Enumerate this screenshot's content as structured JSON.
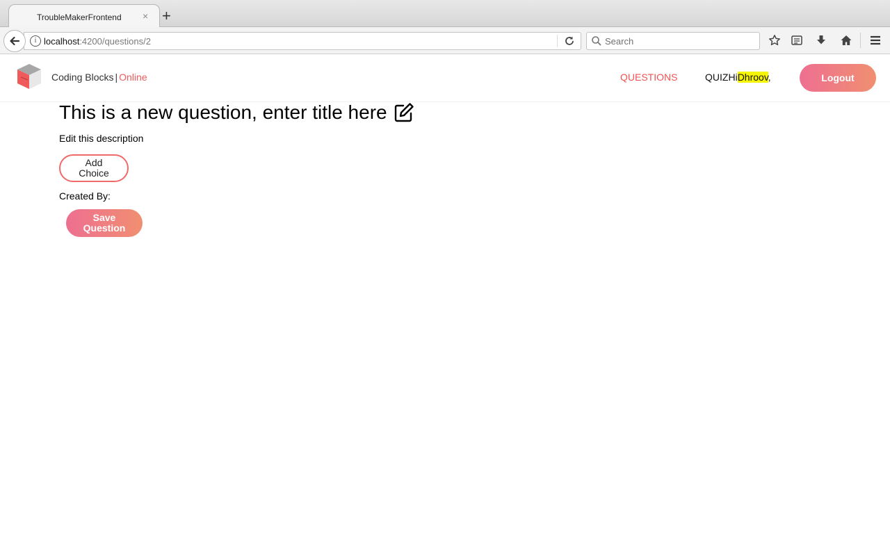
{
  "browser": {
    "tab_title": "TroubleMakerFrontend",
    "tab_close": "×",
    "new_tab": "+",
    "url_host": "localhost",
    "url_path": ":4200/questions/2",
    "search_placeholder": "Search"
  },
  "header": {
    "brand_name": "Coding Blocks",
    "brand_sep": "|",
    "brand_suffix": "Online",
    "nav_questions": "QUESTIONS",
    "nav_quiz": "QUIZ",
    "greeting": "Hi",
    "user_name": "Dhroov",
    "greeting_suffix": ",",
    "logout_label": "Logout"
  },
  "question": {
    "title": "This is a new question, enter title here",
    "description": "Edit this description",
    "add_choice_label": "Add Choice",
    "created_by_label": "Created By:",
    "save_label": "Save Question"
  },
  "colors": {
    "accent": "#f05252",
    "gradient_start": "#ee6f91",
    "gradient_end": "#f08f70",
    "highlight": "#f7f500"
  },
  "icons": {
    "back": "back-arrow-icon",
    "info": "info-icon",
    "reload": "reload-icon",
    "search": "search-icon",
    "bookmark": "star-icon",
    "reading_list": "reading-list-icon",
    "download": "download-icon",
    "home": "home-icon",
    "menu": "hamburger-menu-icon",
    "edit": "edit-icon",
    "logo": "logo-cube-icon"
  }
}
